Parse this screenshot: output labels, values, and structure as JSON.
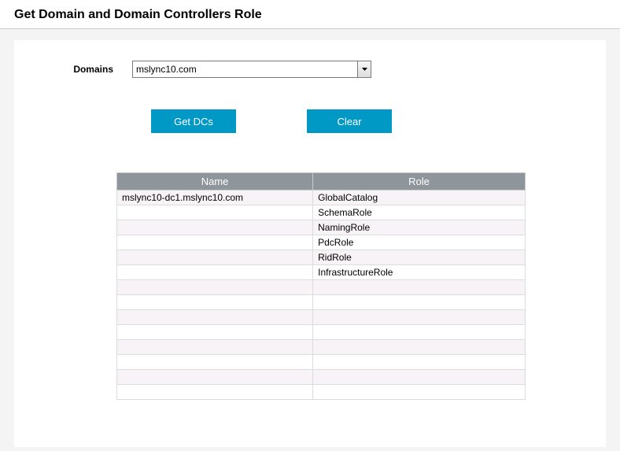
{
  "title": "Get Domain and Domain Controllers Role",
  "form": {
    "domains_label": "Domains",
    "domains_selected": "mslync10.com"
  },
  "buttons": {
    "get_dcs": "Get DCs",
    "clear": "Clear"
  },
  "table": {
    "headers": {
      "name": "Name",
      "role": "Role"
    },
    "rows": [
      {
        "name": "mslync10-dc1.mslync10.com",
        "role": "GlobalCatalog"
      },
      {
        "name": "",
        "role": "SchemaRole"
      },
      {
        "name": "",
        "role": "NamingRole"
      },
      {
        "name": "",
        "role": "PdcRole"
      },
      {
        "name": "",
        "role": "RidRole"
      },
      {
        "name": "",
        "role": "InfrastructureRole"
      },
      {
        "name": "",
        "role": ""
      },
      {
        "name": "",
        "role": ""
      },
      {
        "name": "",
        "role": ""
      },
      {
        "name": "",
        "role": ""
      },
      {
        "name": "",
        "role": ""
      },
      {
        "name": "",
        "role": ""
      },
      {
        "name": "",
        "role": ""
      },
      {
        "name": "",
        "role": ""
      }
    ]
  }
}
